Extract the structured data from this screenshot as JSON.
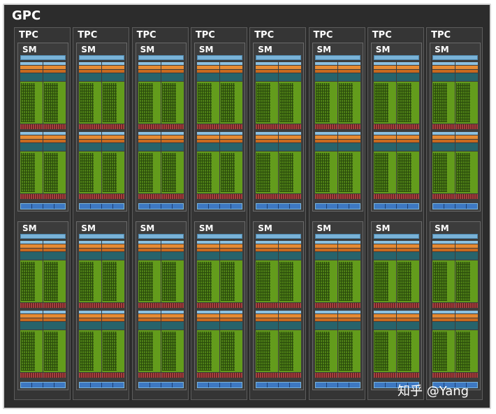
{
  "gpc": {
    "label": "GPC"
  },
  "tpc_label": "TPC",
  "sm_label": "SM",
  "tpc_count": 8,
  "sms_per_tpc": 2,
  "watermark": "知乎 @Yang",
  "colors": {
    "background": "#2c2c2c",
    "l1_cache": "#7ab3d8",
    "dispatch": "#e68a32",
    "register_file": "#27636b",
    "cores": "#639c1c",
    "load_store": "#7a2a2a",
    "texture": "#3d78c2"
  }
}
